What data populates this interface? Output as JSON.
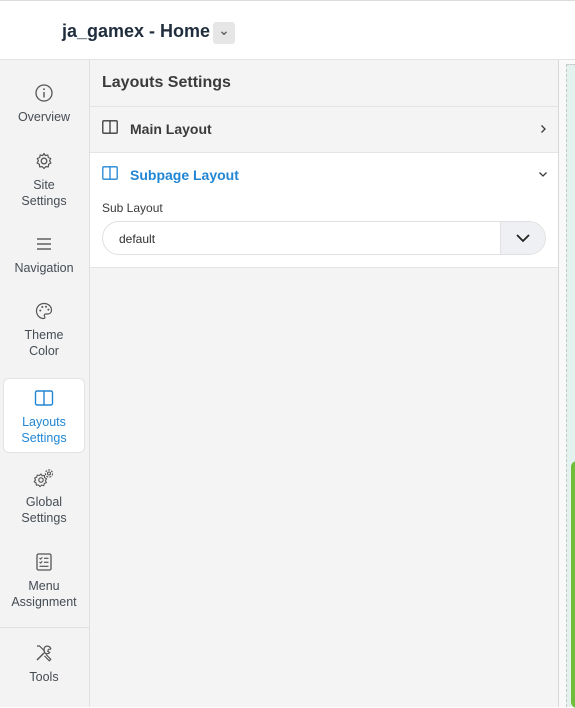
{
  "header": {
    "site_title": "ja_gamex - Home",
    "dropdown_icon": "chevron-down-icon"
  },
  "sidebar": {
    "items": [
      {
        "label": "Overview",
        "icon": "info-icon"
      },
      {
        "label": "Site Settings",
        "icon": "gear-icon"
      },
      {
        "label": "Navigation",
        "icon": "menu-lines-icon"
      },
      {
        "label": "Theme Color",
        "icon": "palette-icon"
      },
      {
        "label": "Layouts Settings",
        "icon": "columns-layout-icon",
        "active": true
      },
      {
        "label": "Global Settings",
        "icon": "gears-icon"
      },
      {
        "label": "Menu Assignment",
        "icon": "checklist-icon"
      },
      {
        "label": "Tools",
        "icon": "tools-icon"
      }
    ]
  },
  "panel": {
    "title": "Layouts Settings",
    "sections": [
      {
        "label": "Main Layout",
        "icon": "columns-layout-icon",
        "expanded": false
      },
      {
        "label": "Subpage Layout",
        "icon": "columns-layout-icon",
        "expanded": true,
        "field": {
          "label": "Sub Layout",
          "value": "default"
        }
      }
    ]
  },
  "colors": {
    "accent": "#2186d4",
    "sidebar_bg": "#f3f3f3",
    "panel_bg": "#f4f4f4",
    "text": "#3b3b3b"
  }
}
